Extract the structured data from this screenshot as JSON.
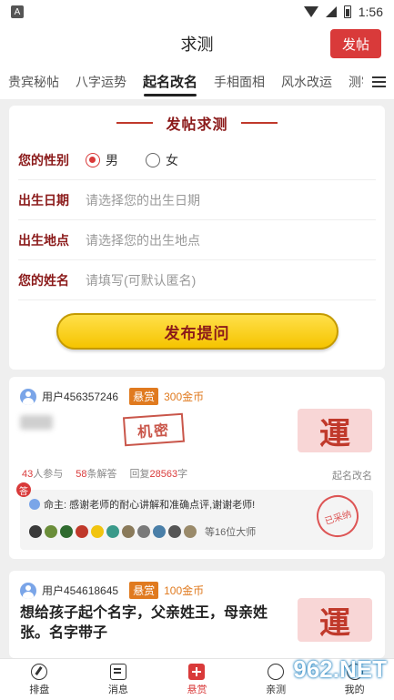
{
  "status_bar": {
    "time": "1:56",
    "app_icon_letter": "A"
  },
  "header": {
    "title": "求测",
    "post_button": "发帖"
  },
  "tabs": [
    "贵宾秘帖",
    "八字运势",
    "起名改名",
    "手相面相",
    "风水改运",
    "测字解"
  ],
  "active_tab_index": 2,
  "form": {
    "heading": "发帖求测",
    "gender_label": "您的性别",
    "gender_options": [
      "男",
      "女"
    ],
    "gender_selected": "男",
    "birth_date_label": "出生日期",
    "birth_date_placeholder": "请选择您的出生日期",
    "birth_place_label": "出生地点",
    "birth_place_placeholder": "请选择您的出生地点",
    "name_label": "您的姓名",
    "name_placeholder": "请填写(可默认匿名)",
    "submit_label": "发布提问"
  },
  "posts": [
    {
      "user": "用户456357246",
      "bounty_tag": "悬赏",
      "bounty_amount": "300金币",
      "secret_stamp": "机密",
      "thumb_char": "運",
      "participants_num": "43",
      "participants_label": "人参与",
      "answers_num": "58",
      "answers_label": "条解答",
      "reply_prefix": "回复",
      "reply_num": "28563",
      "reply_suffix": "字",
      "category": "起名改名",
      "answer_badge": "答",
      "answer_text": "命主: 感谢老师的耐心讲解和准确点评,谢谢老师!",
      "adopted_stamp": "已采纳",
      "masters_text": "等16位大师"
    },
    {
      "user": "用户454618645",
      "bounty_tag": "悬赏",
      "bounty_amount": "100金币",
      "title": "想给孩子起个名字，父亲姓王，母亲姓张。名字带子",
      "thumb_char": "運"
    }
  ],
  "bottom_nav": [
    {
      "label": "排盘",
      "icon": "compass-icon"
    },
    {
      "label": "消息",
      "icon": "message-icon"
    },
    {
      "label": "悬赏",
      "icon": "plus-icon"
    },
    {
      "label": "亲测",
      "icon": "person-icon"
    },
    {
      "label": "我的",
      "icon": "user-icon"
    }
  ],
  "watermark": "962.NET",
  "colors": {
    "brand_red": "#d93a3a",
    "dark_red": "#8b1a1a",
    "gold": "#f5c400",
    "orange": "#e07a1f"
  }
}
